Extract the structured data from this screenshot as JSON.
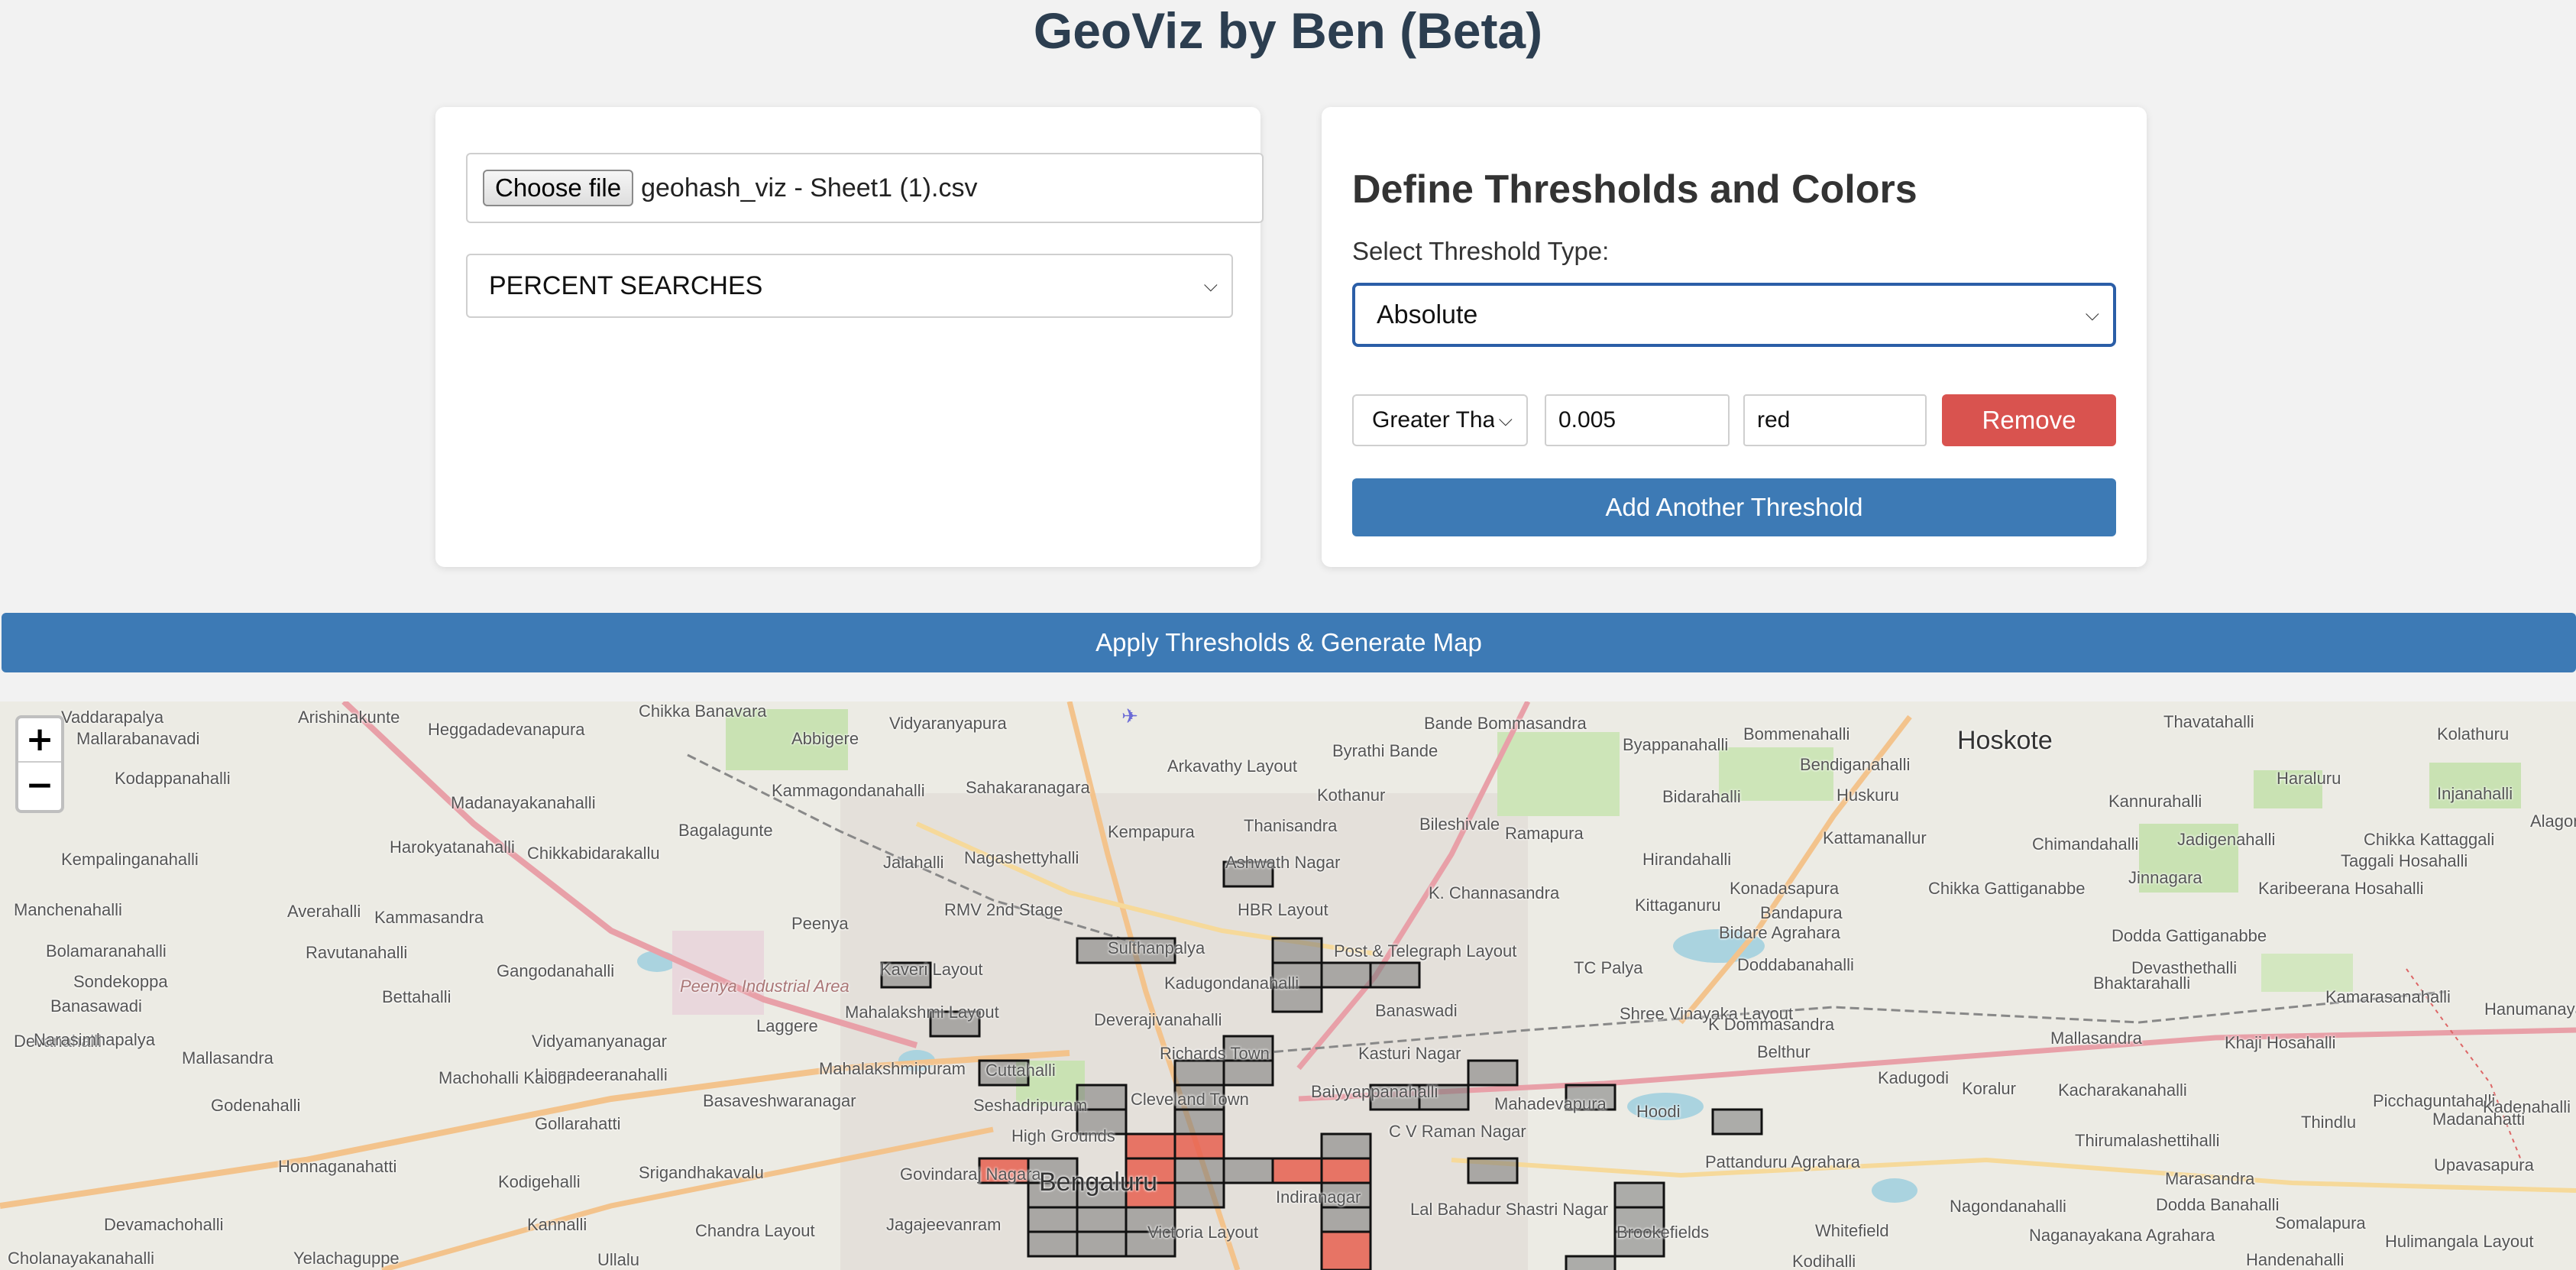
{
  "title": "GeoViz by Ben (Beta)",
  "upload": {
    "choose_file_label": "Choose file",
    "file_name": "geohash_viz - Sheet1 (1).csv"
  },
  "metric_select": {
    "selected": "PERCENT SEARCHES"
  },
  "thresholds": {
    "heading": "Define Thresholds and Colors",
    "type_label": "Select Threshold Type:",
    "type_selected": "Absolute",
    "rows": [
      {
        "condition": "Greater Thar",
        "value": "0.005",
        "color": "red",
        "remove_label": "Remove"
      }
    ],
    "add_label": "Add Another Threshold"
  },
  "apply_label": "Apply Thresholds & Generate Map",
  "map": {
    "zoom_in": "+",
    "zoom_out": "−",
    "places": [
      "Vaddarapalya",
      "Arishinakunte",
      "Heggadadevanapura",
      "Chikka Banavara",
      "Vidyaranyapura",
      "Bande Bommasandra",
      "Bommenahalli",
      "Thavatahalli",
      "Kolathuru",
      "Mallarabanavadi",
      "Abbigere",
      "Byrathi Bande",
      "Byappanahalli",
      "Bendiganahalli",
      "Hoskote",
      "Kodappanahalli",
      "Arkavathy Layout",
      "Haraluru",
      "Injanahalli",
      "Madanayakanahalli",
      "Kammagondanahalli",
      "Sahakaranagara",
      "Kothanur",
      "Bidarahalli",
      "Huskuru",
      "Kannurahalli",
      "Alagondana",
      "Harokyatanahalli",
      "Bagalagunte",
      "Thanisandra",
      "Bileshivale",
      "Kempalinganahalli",
      "Chikkabidarakallu",
      "Kempapura",
      "Ramapura",
      "Kattamanallur",
      "Chimandahalli",
      "Chikka Kattaggali",
      "Jalahalli",
      "Nagashettyhalli",
      "Ashwath Nagar",
      "Hirandahalli",
      "Jadigenahalli",
      "Taggali Hosahalli",
      "Manchenahalli",
      "Averahalli",
      "Kammasandra",
      "RMV 2nd Stage",
      "HBR Layout",
      "K. Channasandra",
      "Konadasapura",
      "Kittaganuru",
      "Bandapura",
      "Chikka Gattiganabbe",
      "Karibeerana Hosahalli",
      "Jinnagara",
      "Ravutanahalli",
      "Peenya",
      "Sulthanpalya",
      "Post & Telegraph Layout",
      "Bidare Agrahara",
      "Bolamaranahalli",
      "Gangodanahalli",
      "Dodda Gattiganabbe",
      "Sondekoppa",
      "Kaveri Layout",
      "Kadugondanahalli",
      "TC Palya",
      "Doddabanahalli",
      "Devasthethalli",
      "Bettahalli",
      "Peenya Industrial Area",
      "Banaswadi",
      "Bhaktarahalli",
      "Kamarasanahalli",
      "Banasawadi",
      "Mahalakshmi Layout",
      "Deverajivanahalli",
      "Shree Vinayaka Layout",
      "Hanumanayaka",
      "Laggere",
      "K Dommasandra",
      "Devanahalli",
      "Vidyamanyanagar",
      "Richards Town",
      "Kasturi Nagar",
      "Mallasandra",
      "Khaji Hosahalli",
      "Narasimhapalya",
      "Mallasandra",
      "Lingadeeranahalli",
      "Mahalakshmipuram",
      "Cuttahalli",
      "Belthur",
      "Kadugodi",
      "Machohalli Kaloni",
      "Basaveshwaranagar",
      "Seshadripuram",
      "Cleveland Town",
      "Baiyyappanahalli",
      "Mahadevapura",
      "Hoodi",
      "Koralur",
      "Kacharakanahalli",
      "Picchaguntahalli",
      "Godenahalli",
      "Gollarahatti",
      "High Grounds",
      "C V Raman Nagar",
      "Kadenahalli",
      "Thirumalashettihalli",
      "Thindlu",
      "Madanahatti",
      "Honnaganahatti",
      "Govindaraj Nagara",
      "Bengaluru",
      "Kodigehalli",
      "Srigandhakavalu",
      "Pattanduru Agrahara",
      "Marasandra",
      "Upavasapura",
      "Indiranagar",
      "Lal Bahadur Shastri Nagar",
      "Nagondanahalli",
      "Dodda Banahalli",
      "Devamachohalli",
      "Kannalli",
      "Chandra Layout",
      "Jagajeevanram",
      "Victoria Layout",
      "Brookefields",
      "Whitefield",
      "Naganayakana Agrahara",
      "Somalapura",
      "Hulimangala Layout",
      "Cholanayakanahalli",
      "Yelachaguppe",
      "Ullalu",
      "Kodihalli",
      "Handenahalli"
    ]
  }
}
